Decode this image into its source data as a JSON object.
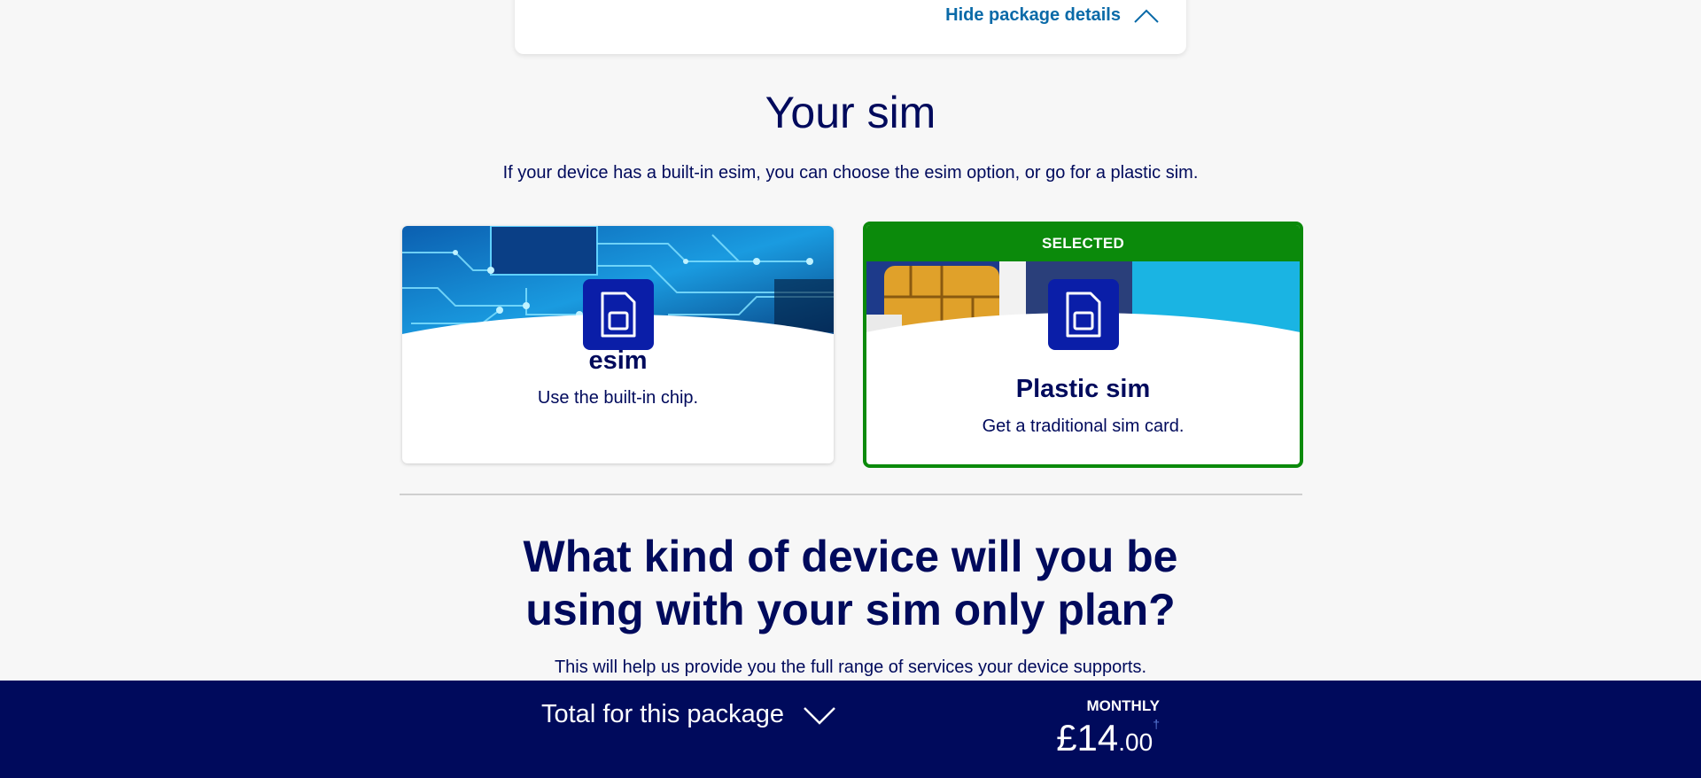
{
  "package_card": {
    "hide_details_label": "Hide package details"
  },
  "your_sim": {
    "title": "Your sim",
    "subtitle": "If your device has a built-in esim, you can choose the esim option, or go for a plastic sim.",
    "options": [
      {
        "name": "esim",
        "description": "Use the built-in chip.",
        "selected": false
      },
      {
        "name": "Plastic sim",
        "description": "Get a traditional sim card.",
        "selected": true,
        "badge": "SELECTED"
      }
    ]
  },
  "device_question": {
    "title_line1": "What kind of device will you be",
    "title_line2": "using with your sim only plan?",
    "subtitle": "This will help us provide you the full range of services your device supports."
  },
  "total_bar": {
    "label": "Total for this package",
    "period": "MONTHLY",
    "price_pounds": "£14",
    "price_pence": ".00",
    "dagger": "†"
  },
  "colors": {
    "navy": "#000a5c",
    "selected_green": "#0b8a0b",
    "icon_blue": "#0a1ea8",
    "link_blue": "#0a6aa8"
  }
}
